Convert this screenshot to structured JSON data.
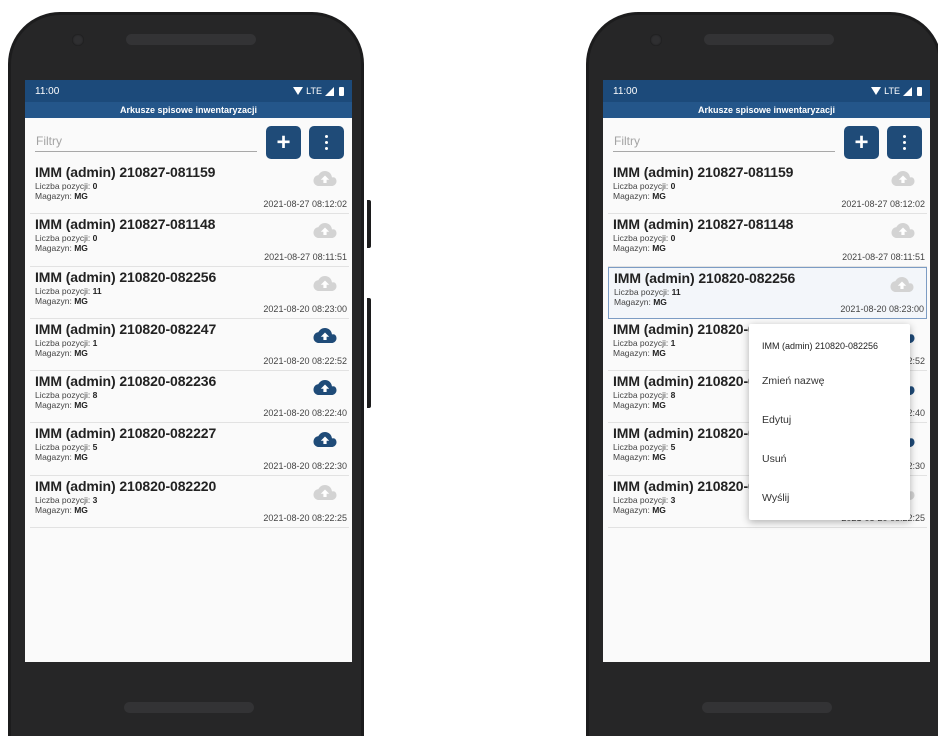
{
  "status": {
    "time": "11:00",
    "network": "LTE"
  },
  "app": {
    "title": "Arkusze spisowe inwentaryzacji"
  },
  "filter": {
    "placeholder": "Filtry"
  },
  "toolbar": {
    "add_label": "+"
  },
  "labels": {
    "count": "Liczba pozycji: ",
    "warehouse": "Magazyn: "
  },
  "colors": {
    "status_bar": "#1c4a7a",
    "title_bar": "#24568a",
    "button": "#1f4b78",
    "cloud_active": "#1f4b78",
    "cloud_inactive": "#d3d3d3"
  },
  "items": [
    {
      "title": "IMM (admin) 210827-081159",
      "count": "0",
      "warehouse": "MG",
      "date": "2021-08-27 08:12:02",
      "icon": "cloud-upload-icon",
      "active": false
    },
    {
      "title": "IMM (admin) 210827-081148",
      "count": "0",
      "warehouse": "MG",
      "date": "2021-08-27 08:11:51",
      "icon": "cloud-upload-icon",
      "active": false
    },
    {
      "title": "IMM (admin) 210820-082256",
      "count": "11",
      "warehouse": "MG",
      "date": "2021-08-20 08:23:00",
      "icon": "cloud-upload-icon",
      "active": false
    },
    {
      "title": "IMM (admin) 210820-082247",
      "count": "1",
      "warehouse": "MG",
      "date": "2021-08-20 08:22:52",
      "icon": "cloud-upload-icon",
      "active": true
    },
    {
      "title": "IMM (admin) 210820-082236",
      "count": "8",
      "warehouse": "MG",
      "date": "2021-08-20 08:22:40",
      "icon": "cloud-upload-icon",
      "active": true
    },
    {
      "title": "IMM (admin) 210820-082227",
      "count": "5",
      "warehouse": "MG",
      "date": "2021-08-20 08:22:30",
      "icon": "cloud-upload-icon",
      "active": true
    },
    {
      "title": "IMM (admin) 210820-082220",
      "count": "3",
      "warehouse": "MG",
      "date": "2021-08-20 08:22:25",
      "icon": "cloud-upload-icon",
      "active": false
    }
  ],
  "context_menu": {
    "header": "IMM (admin) 210820-082256",
    "items": [
      "Zmień nazwę",
      "Edytuj",
      "Usuń",
      "Wyślij"
    ]
  }
}
